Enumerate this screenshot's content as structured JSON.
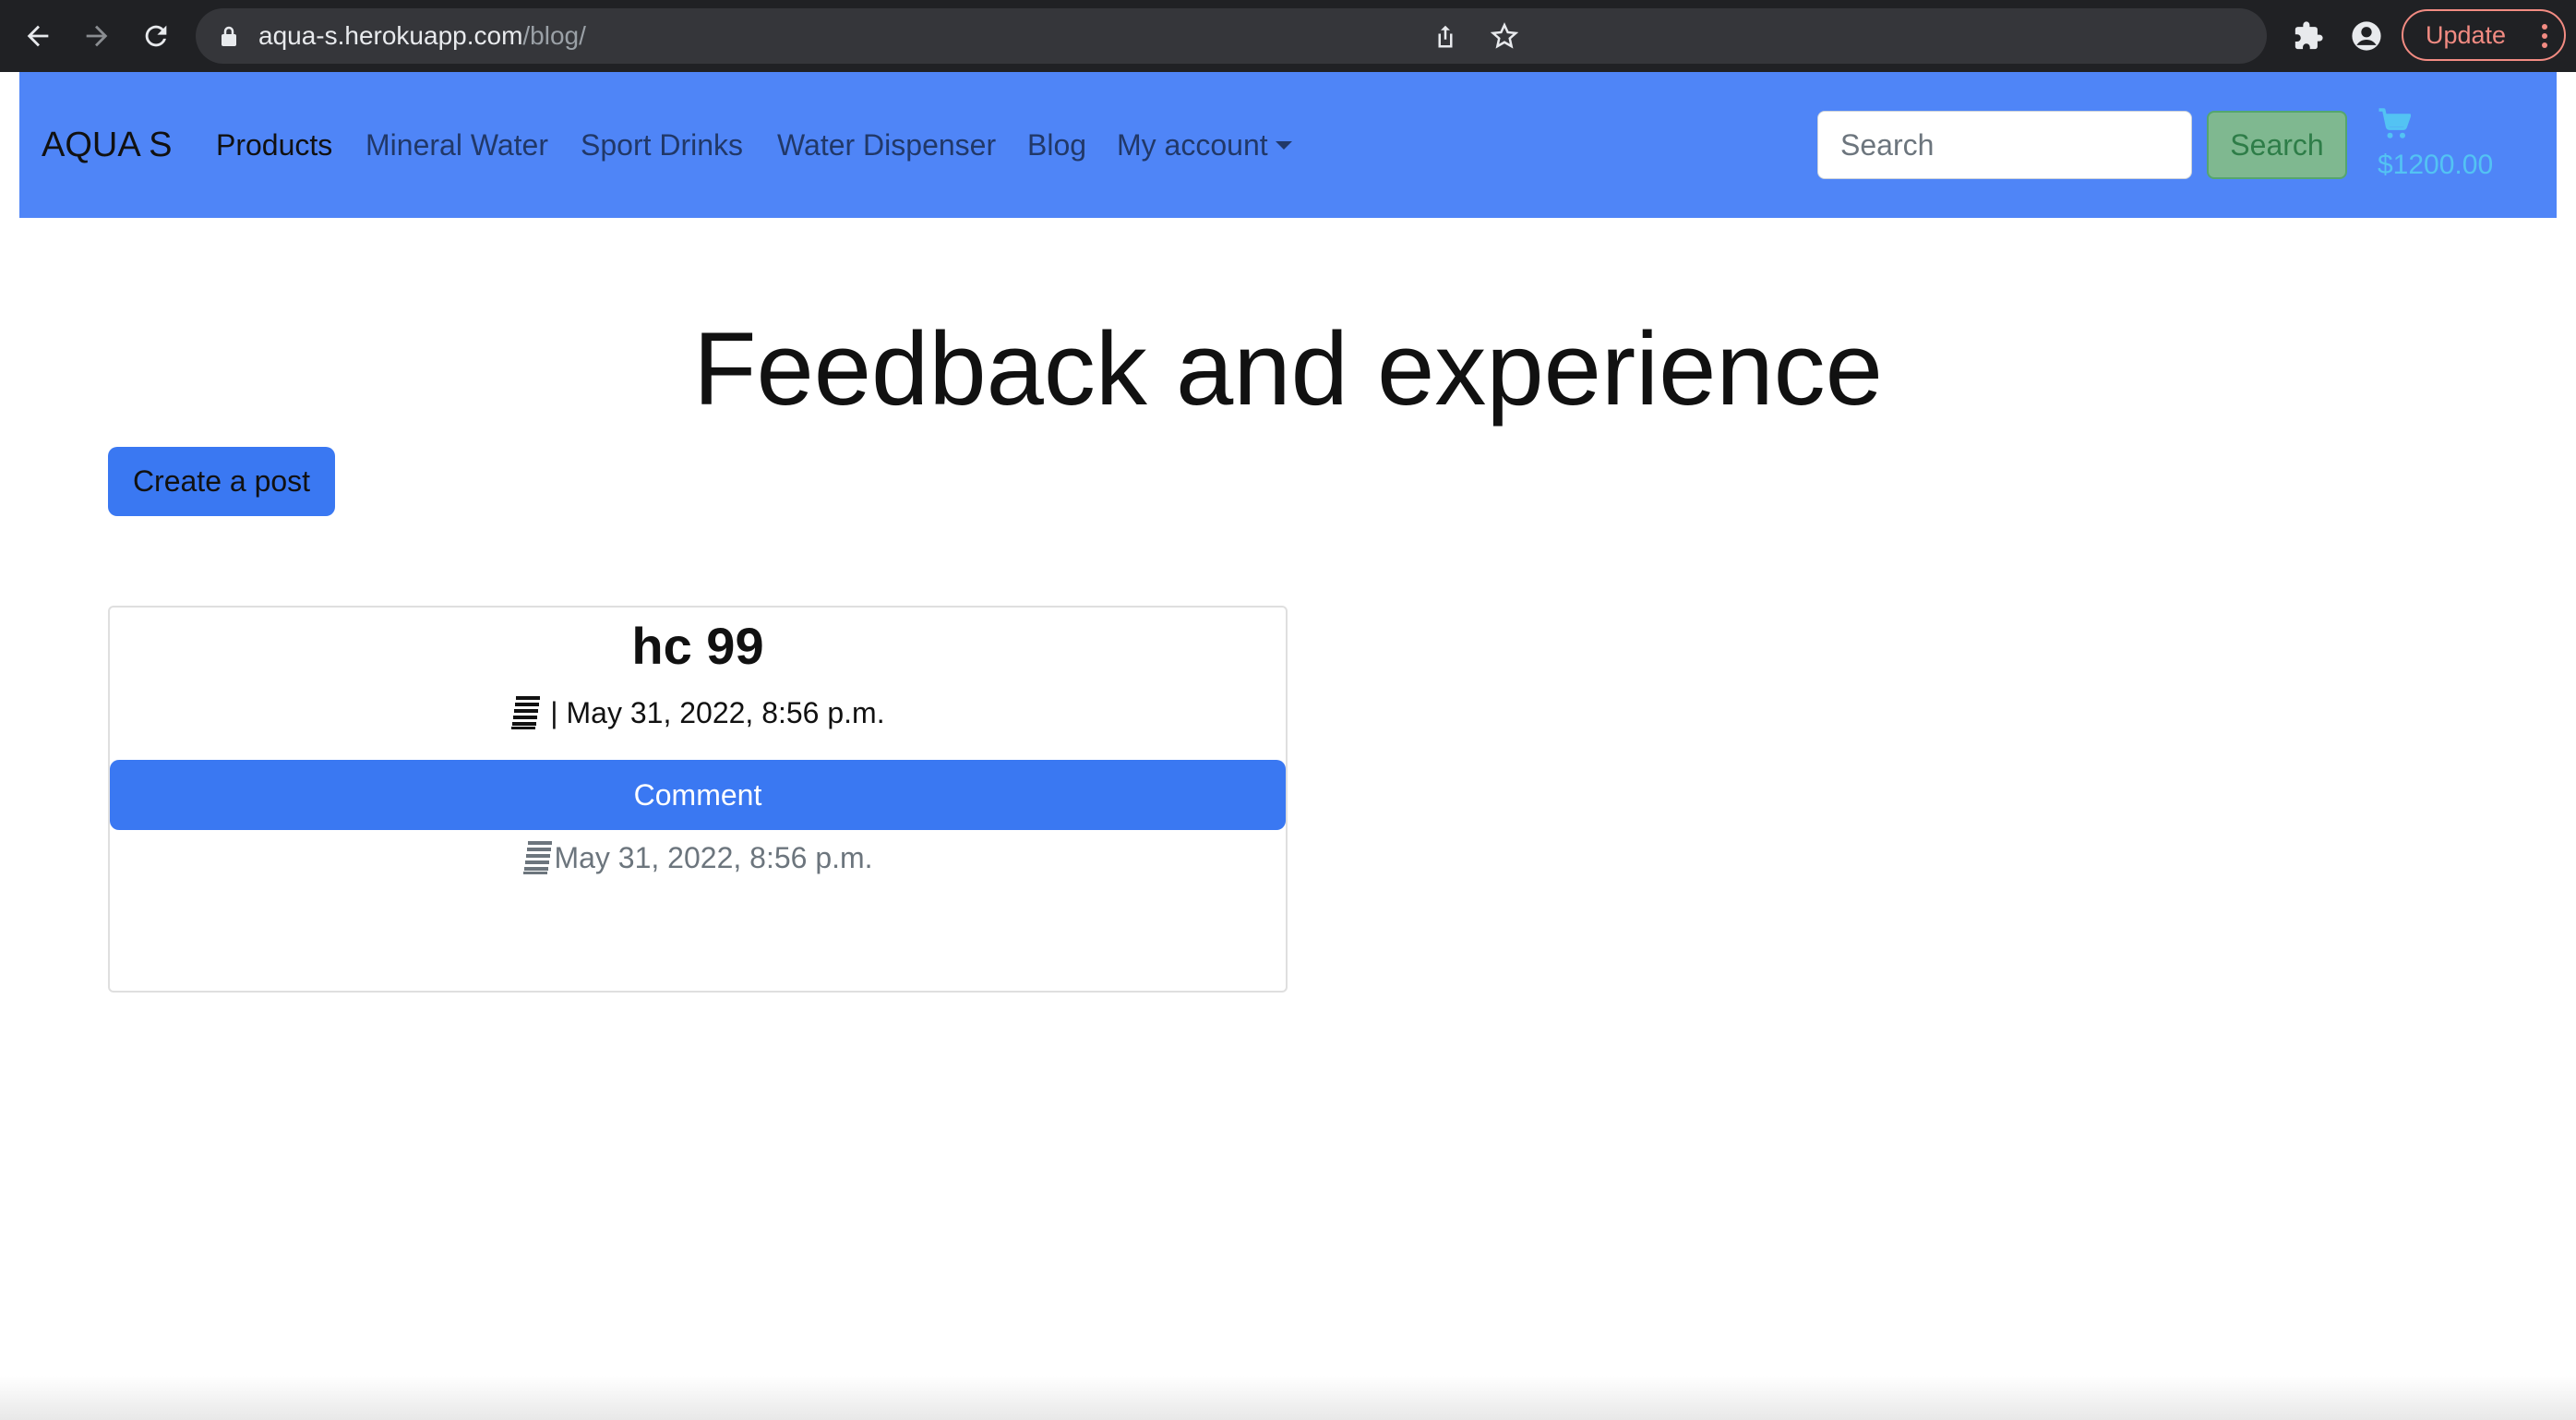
{
  "browser": {
    "url_host": "aqua-s.herokuapp.com",
    "url_path": "/blog/",
    "update_label": "Update"
  },
  "navbar": {
    "brand": "AQUA S",
    "links": [
      {
        "label": "Products",
        "active": true
      },
      {
        "label": "Mineral Water"
      },
      {
        "label": "Sport Drinks"
      },
      {
        "label": "Water Dispenser"
      },
      {
        "label": "Blog"
      },
      {
        "label": "My account"
      }
    ],
    "search_placeholder": "Search",
    "search_button": "Search",
    "cart_total": "$1200.00"
  },
  "page": {
    "title": "Feedback and experience",
    "create_post_label": "Create a post"
  },
  "post": {
    "title": "hc 99",
    "meta": "| May 31, 2022, 8:56 p.m.",
    "comment_button": "Comment",
    "comment_meta": "May 31, 2022, 8:56 p.m."
  },
  "colors": {
    "navbar": "#4f85f7",
    "primary_button": "#3a78f2",
    "success_button": "#7fb890",
    "cart_text": "#53c3f3",
    "chrome": "#202124",
    "update_accent": "#f28b82"
  },
  "icons": {
    "cart": "shopping-cart-icon",
    "post_meta": "document-icon",
    "lock": "lock-icon"
  }
}
